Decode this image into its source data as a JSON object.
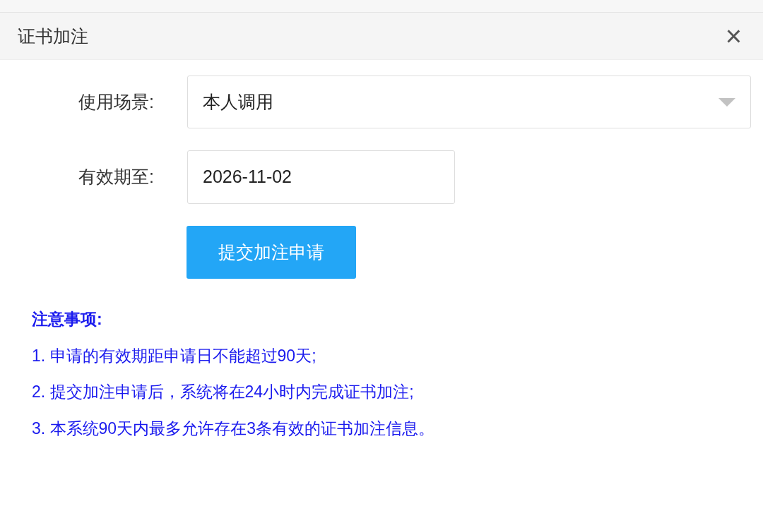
{
  "dialog": {
    "title": "证书加注",
    "close": "×"
  },
  "form": {
    "fields": [
      {
        "kind": "select",
        "label": "使用场景:",
        "value": "本人调用"
      },
      {
        "kind": "date",
        "label": "有效期至:",
        "value": "2026-11-02"
      }
    ],
    "submit": "提交加注申请"
  },
  "notes": {
    "title": "注意事项:",
    "items": [
      "1. 申请的有效期距申请日不能超过90天;",
      "2. 提交加注申请后，系统将在24小时内完成证书加注;",
      "3. 本系统90天内最多允许存在3条有效的证书加注信息。"
    ]
  }
}
